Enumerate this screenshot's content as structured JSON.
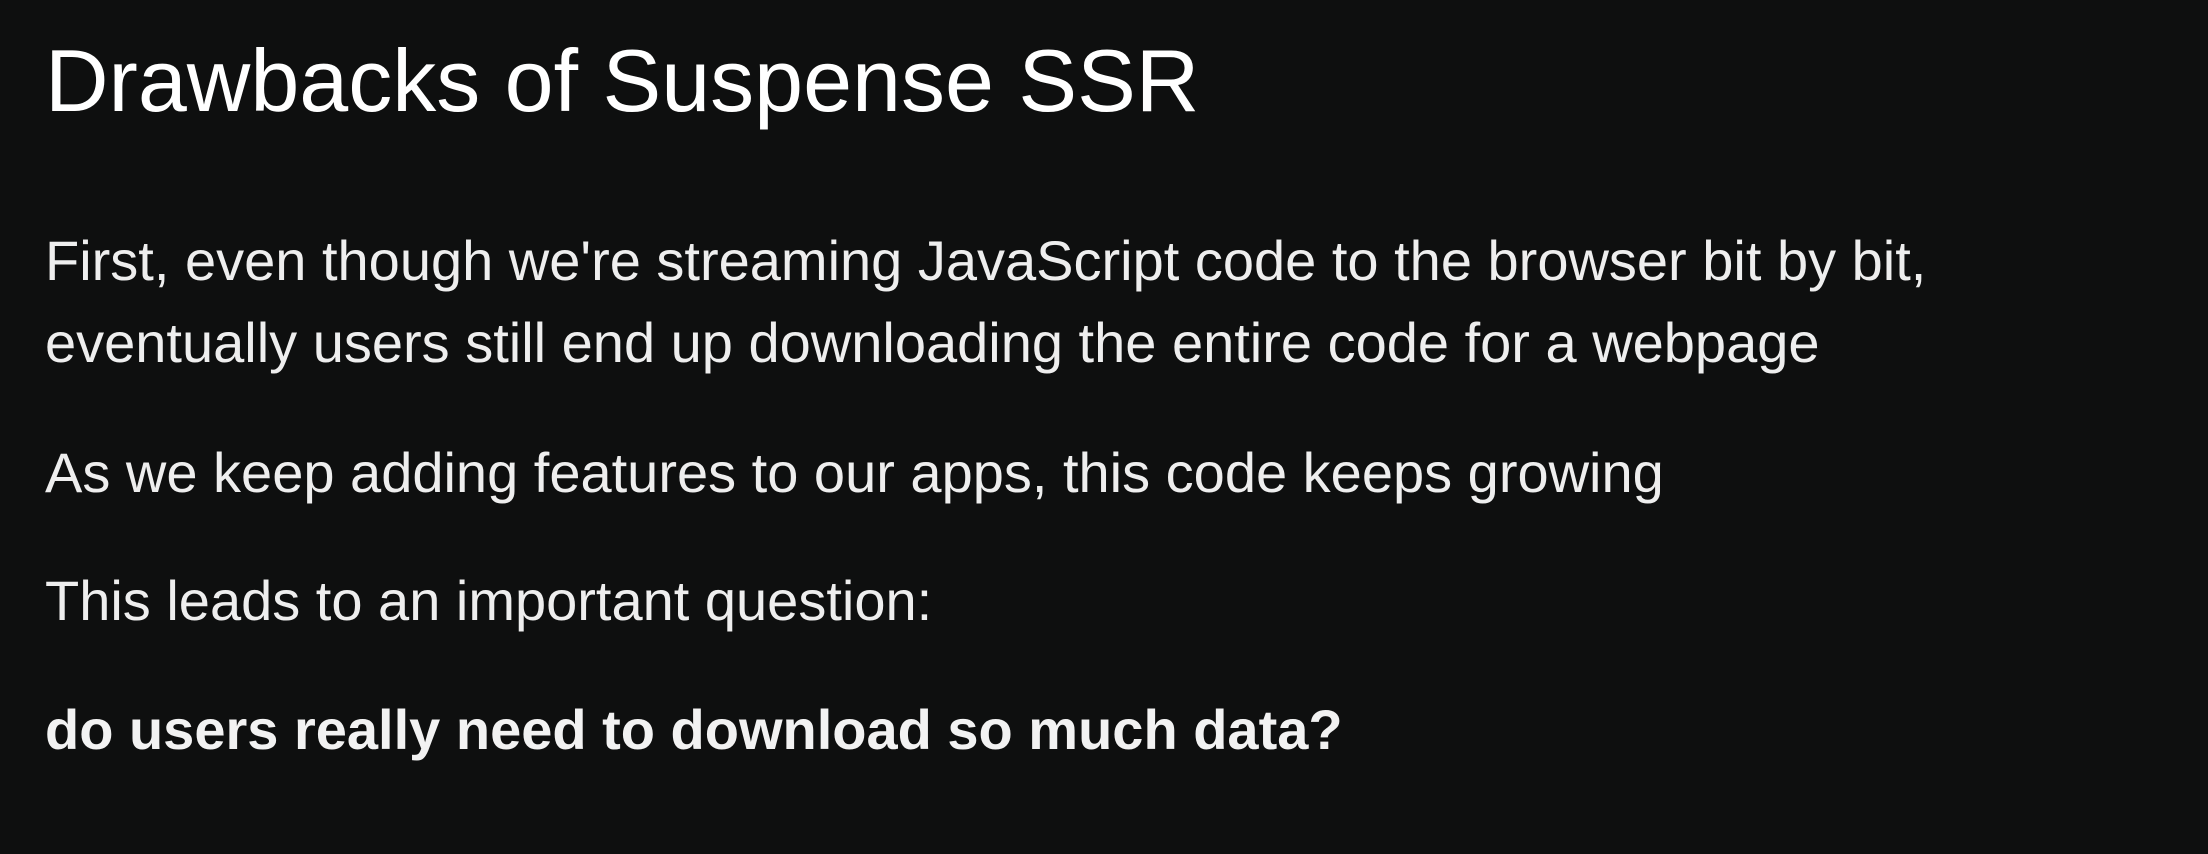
{
  "slide": {
    "title": "Drawbacks of Suspense SSR",
    "paragraph_1": {
      "line_1": "First, even though we're streaming JavaScript code to the browser bit by bit,",
      "line_2": "eventually users still end up downloading the entire code for a webpage"
    },
    "paragraph_2": "As we keep adding features to our apps, this code keeps growing",
    "paragraph_3": "This leads to an important question:",
    "question": "do users really need to download so much data?"
  },
  "colors": {
    "background": "#0e0f0f",
    "text": "#ffffff"
  }
}
